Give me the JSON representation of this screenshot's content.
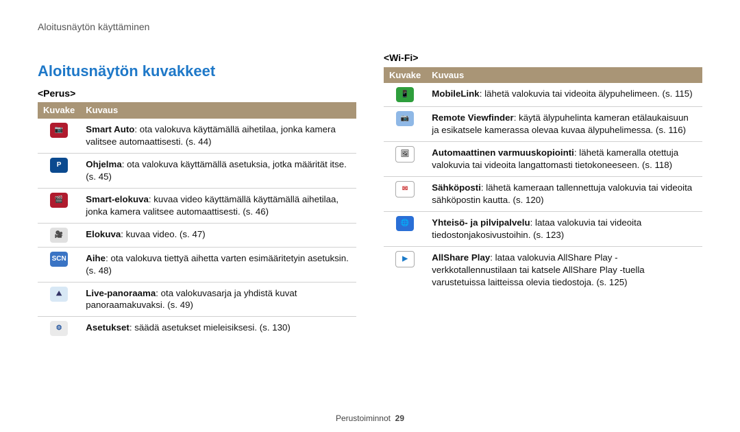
{
  "breadcrumb": "Aloitusnäytön käyttäminen",
  "title": "Aloitusnäytön kuvakkeet",
  "sub_left": "<Perus>",
  "sub_right": "<Wi-Fi>",
  "headers": {
    "c1": "Kuvake",
    "c2": "Kuvaus"
  },
  "left_rows": [
    {
      "icon": {
        "bg": "#b01b2e",
        "label": "📷",
        "name": "smart-auto-icon"
      },
      "title": "Smart Auto",
      "desc": ": ota valokuva käyttämällä aihetilaa, jonka kamera valitsee automaattisesti. (s. 44)"
    },
    {
      "icon": {
        "bg": "#0b4a8f",
        "label": "P",
        "name": "program-icon"
      },
      "title": "Ohjelma",
      "desc": ": ota valokuva käyttämällä asetuksia, jotka määrität itse. (s. 45)"
    },
    {
      "icon": {
        "bg": "#b01b2e",
        "label": "🎬",
        "name": "smart-movie-icon"
      },
      "title": "Smart-elokuva",
      "desc": ": kuvaa video käyttämällä käyttämällä aihetilaa, jonka kamera valitsee automaattisesti. (s. 46)"
    },
    {
      "icon": {
        "bg": "#e0e0e0",
        "label": "🎥",
        "name": "movie-icon",
        "fg": "#333"
      },
      "title": "Elokuva",
      "desc": ": kuvaa video. (s. 47)"
    },
    {
      "icon": {
        "bg": "#3a74c4",
        "label": "SCN",
        "name": "scene-icon"
      },
      "title": "Aihe",
      "desc": ": ota valokuva tiettyä aihetta varten esimääritetyin asetuksin. (s. 48)"
    },
    {
      "icon": {
        "bg": "#d8e8f5",
        "label": "⛰",
        "name": "panorama-icon",
        "fg": "#336"
      },
      "title": "Live-panoraama",
      "desc": ": ota valokuvasarja ja yhdistä kuvat panoraamakuvaksi. (s. 49)"
    },
    {
      "icon": {
        "bg": "#eaeaea",
        "label": "⚙",
        "name": "settings-icon",
        "fg": "#1b4f9c"
      },
      "title": "Asetukset",
      "desc": ": säädä asetukset mieleisiksesi. (s. 130)"
    }
  ],
  "right_rows": [
    {
      "icon": {
        "bg": "#2e9e3c",
        "label": "📱",
        "name": "mobilelink-icon"
      },
      "title": "MobileLink",
      "desc": ": lähetä valokuvia tai videoita älypuhelimeen. (s. 115)"
    },
    {
      "icon": {
        "bg": "#8fb8e6",
        "label": "📷",
        "name": "remote-viewfinder-icon"
      },
      "title": "Remote Viewfinder",
      "desc": ": käytä älypuhelinta kameran etälaukaisuun ja esikatsele kamerassa olevaa kuvaa älypuhelimessa. (s. 116)"
    },
    {
      "icon": {
        "bg": "#ffffff",
        "label": "🖼",
        "name": "auto-backup-icon",
        "fg": "#444",
        "border": "#aaa"
      },
      "title": "Automaattinen varmuuskopiointi",
      "desc": ": lähetä kameralla otettuja valokuvia tai videoita langattomasti tietokoneeseen. (s. 118)"
    },
    {
      "icon": {
        "bg": "#ffffff",
        "label": "✉",
        "name": "email-icon",
        "fg": "#c33",
        "border": "#aaa"
      },
      "title": "Sähköposti",
      "desc": ": lähetä kameraan tallennettuja valokuvia tai videoita sähköpostin kautta. (s. 120)"
    },
    {
      "icon": {
        "bg": "#2a6fd6",
        "label": "🌐",
        "name": "cloud-sharing-icon"
      },
      "title": "Yhteisö- ja pilvipalvelu",
      "desc": ": lataa valokuvia tai videoita tiedostonjakosivustoihin. (s. 123)"
    },
    {
      "icon": {
        "bg": "#ffffff",
        "label": "▶",
        "name": "allshare-play-icon",
        "fg": "#1a7ac8",
        "border": "#aaa"
      },
      "title": "AllShare Play",
      "desc": ": lataa valokuvia AllShare Play -verkkotallennustilaan tai katsele AllShare Play -tuella varustetuissa laitteissa olevia tiedostoja. (s. 125)"
    }
  ],
  "footer": {
    "section": "Perustoiminnot",
    "page": "29"
  }
}
